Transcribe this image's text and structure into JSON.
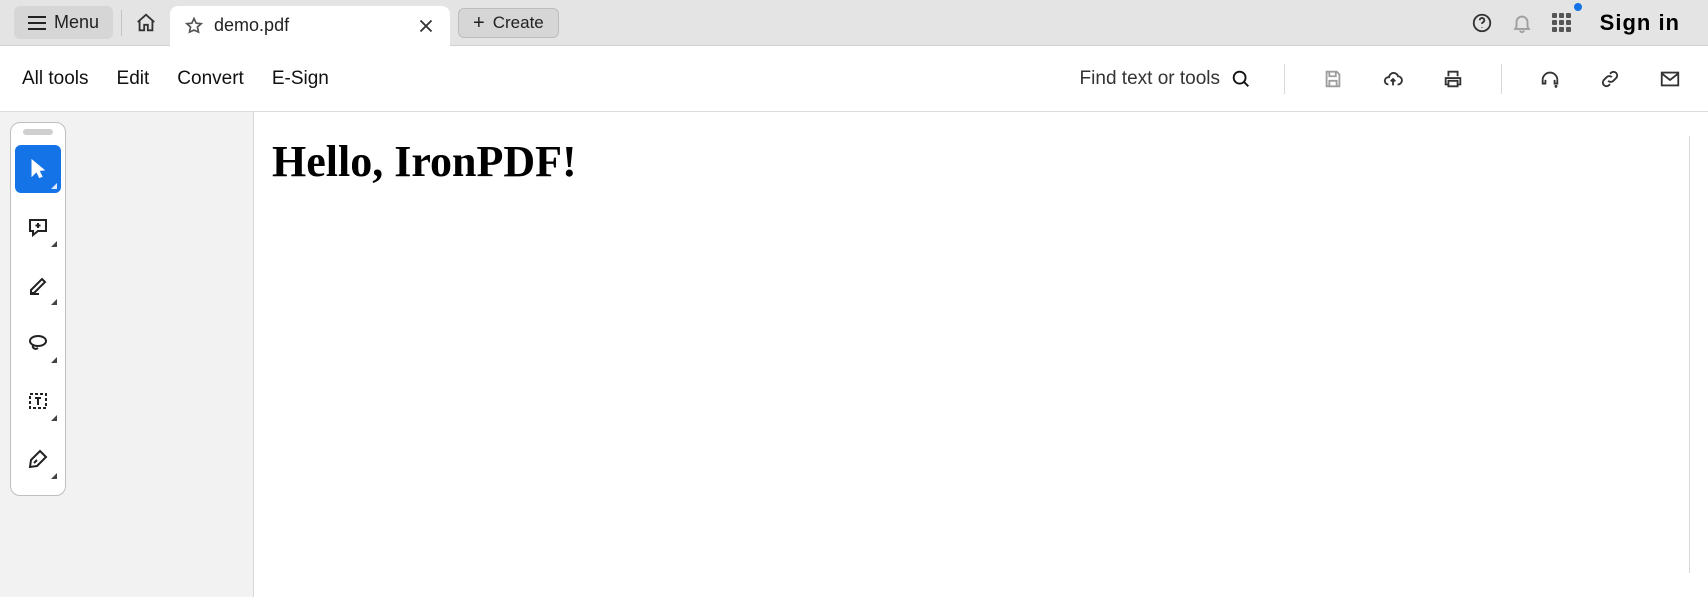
{
  "chrome": {
    "menu_label": "Menu",
    "tab_title": "demo.pdf",
    "create_label": "Create",
    "signin_label": "Sign in"
  },
  "toolbar": {
    "items": [
      "All tools",
      "Edit",
      "Convert",
      "E-Sign"
    ],
    "find_placeholder": "Find text or tools"
  },
  "document": {
    "heading": "Hello, IronPDF!"
  },
  "sidebar_tools": [
    "select-tool",
    "comment-tool",
    "highlight-tool",
    "draw-tool",
    "text-box-tool",
    "sign-tool"
  ]
}
